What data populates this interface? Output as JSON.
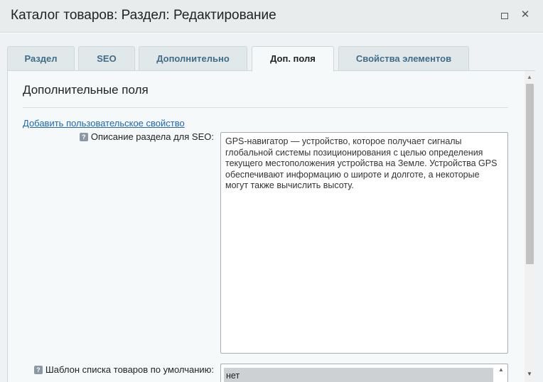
{
  "window": {
    "title": "Каталог товаров: Раздел: Редактирование",
    "maximize_icon": "□",
    "close_icon": "✕"
  },
  "tabs": [
    {
      "label": "Раздел",
      "active": false
    },
    {
      "label": "SEO",
      "active": false
    },
    {
      "label": "Дополнительно",
      "active": false
    },
    {
      "label": "Доп. поля",
      "active": true
    },
    {
      "label": "Свойства элементов",
      "active": false
    }
  ],
  "section": {
    "title": "Дополнительные поля",
    "add_link": "Добавить пользовательское свойство"
  },
  "fields": {
    "help_icon": "?",
    "seo_description": {
      "label": "Описание раздела для SEO:",
      "value": "GPS-навигатор — устройство, которое получает сигналы глобальной системы позиционирования с целью определения текущего местоположения устройства на Земле. Устройства GPS обеспечивают информацию о широте и долготе, а некоторые могут также вычислить высоту."
    },
    "template": {
      "label": "Шаблон списка товаров по умолчанию:",
      "selected": "нет"
    }
  },
  "scrollbar": {
    "up_icon": "▲",
    "down_icon": "▼"
  }
}
